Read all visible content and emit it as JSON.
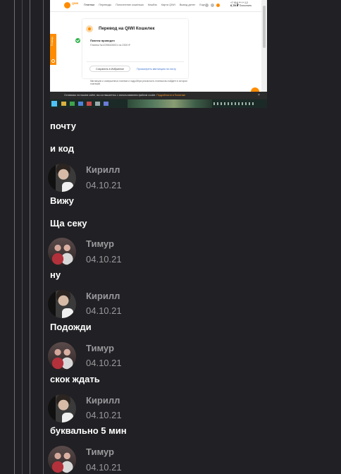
{
  "screenshot": {
    "logo_text": "QIWI",
    "menu": [
      "Платежи",
      "Переводы",
      "Пополнение кошелька",
      "Кешбэк",
      "Карта QIWI",
      "Вывод денег",
      "Еще"
    ],
    "balance_line1": "+7 916 ***-**-12",
    "balance_amount": "6,78 ₽",
    "balance_sub": "Пополнить",
    "side_tab_label": "Помощь",
    "card_title": "Перевод на QIWI Кошелек",
    "status": "Платеж проведен",
    "detail": "Платеж №12396426921 на 2300 ₽",
    "save_button": "Сохранить в Избранное",
    "link": "Просмотреть квитанцию на почту",
    "note": "Квитанцию и совершенных платеже и подробную реальность платежа вы найдете в истории платежей",
    "cookie_text": "Оставаясь на нашем сайте, вы соглашаетесь с использованием файлов cookie.",
    "cookie_link": "Подробности в Политике",
    "cookie_close": "×"
  },
  "messages": [
    {
      "author": "",
      "date": "",
      "text": "почту"
    },
    {
      "author": "",
      "date": "",
      "text": "и код"
    },
    {
      "author": "Кирилл",
      "date": "04.10.21",
      "text": "Вижу"
    },
    {
      "author": "",
      "date": "",
      "text": "Ща секу"
    },
    {
      "author": "Тимур",
      "date": "04.10.21",
      "text": "ну"
    },
    {
      "author": "Кирилл",
      "date": "04.10.21",
      "text": "Подожди"
    },
    {
      "author": "Тимур",
      "date": "04.10.21",
      "text": "скок ждать"
    },
    {
      "author": "Кирилл",
      "date": "04.10.21",
      "text": "буквально 5 мин"
    },
    {
      "author": "Тимур",
      "date": "04.10.21",
      "text": ""
    }
  ],
  "colors": {
    "background": "#212024",
    "author_text": "#9a9a9d",
    "message_text": "#ffffff",
    "qiwi_orange": "#ff8c00"
  }
}
